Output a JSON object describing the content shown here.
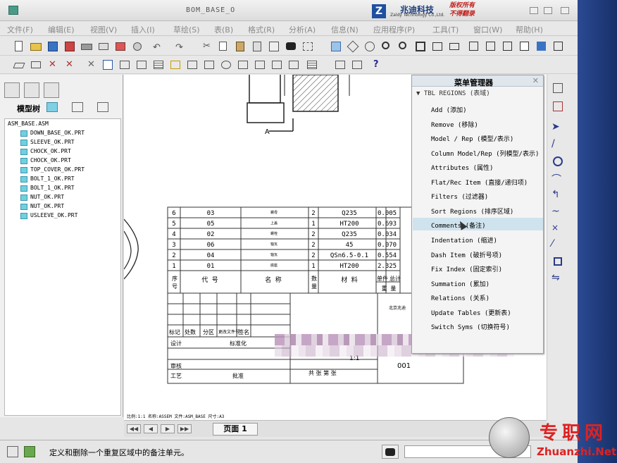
{
  "window": {
    "title": "BOM_BASE_O",
    "logo_text": "兆迪科技",
    "logo_en": "Zaldy Technology Co.,Ltd.",
    "rights_line1": "版权所有",
    "rights_line2": "不得翻录"
  },
  "menu": [
    "文件(F)",
    "编辑(E)",
    "视图(V)",
    "插入(I)",
    "草绘(S)",
    "表(B)",
    "格式(R)",
    "分析(A)",
    "信息(N)",
    "应用程序(P)",
    "工具(T)",
    "窗口(W)",
    "帮助(H)"
  ],
  "model_tree": {
    "label": "模型树",
    "root": "ASM_BASE.ASM",
    "items": [
      "DOWN_BASE_OK.PRT",
      "SLEEVE_OK.PRT",
      "CHOCK_OK.PRT",
      "CHOCK_OK.PRT",
      "TOP_COVER_OK.PRT",
      "BOLT_1_OK.PRT",
      "BOLT_1_OK.PRT",
      "NUT_OK.PRT",
      "NUT_OK.PRT",
      "USLEEVE_OK.PRT"
    ]
  },
  "drawing": {
    "view_label": "A",
    "bom_rows": [
      {
        "no": "6",
        "code": "03",
        "name": "螺母",
        "qty": "2",
        "mat": "Q235",
        "w": "0.005"
      },
      {
        "no": "5",
        "code": "05",
        "name": "上盖",
        "qty": "1",
        "mat": "HT200",
        "w": "0.693"
      },
      {
        "no": "4",
        "code": "02",
        "name": "螺栓",
        "qty": "2",
        "mat": "Q235",
        "w": "0.034"
      },
      {
        "no": "3",
        "code": "06",
        "name": "轴瓦",
        "qty": "2",
        "mat": "45",
        "w": "0.070"
      },
      {
        "no": "2",
        "code": "04",
        "name": "轴瓦",
        "qty": "2",
        "mat": "QSn6.5-0.1",
        "w": "0.554"
      },
      {
        "no": "1",
        "code": "01",
        "name": "底座",
        "qty": "1",
        "mat": "HT200",
        "w": "2.325"
      }
    ],
    "bom_header": {
      "no": "序号",
      "code": "代  号",
      "name": "名  称",
      "qty": "数量",
      "mat": "材  料",
      "single": "单件",
      "total": "总计",
      "weight": "重  量"
    },
    "title_block": {
      "c1": "标记",
      "c2": "处数",
      "c3": "分区",
      "c4": "更改文件号",
      "c5": "签名",
      "design": "设计",
      "std": "标准化",
      "review": "审核",
      "process": "工艺",
      "approve": "批准",
      "scale": "1:1",
      "sheet": "共 张 第 张",
      "code": "001",
      "company": "北京兆迪"
    },
    "footer_text": "比例:1:1    名称:ASSEM    文件:ASM_BASE    尺寸:A3"
  },
  "menu_manager": {
    "title": "菜单管理器",
    "section": "▼ TBL REGIONS (表域)",
    "items": [
      "Add (添加)",
      "Remove (移除)",
      "Model / Rep (模型/表示)",
      "Column Model/Rep (列模型/表示)",
      "Attributes (属性)",
      "Flat/Rec Item (直接/递归项)",
      "Filters (过滤器)",
      "Sort Regions (排序区域)",
      "Comments (备注)",
      "Indentation (缩进)",
      "Dash Item (破折号项)",
      "Fix Index (固定索引)",
      "Summation (累加)",
      "Relations (关系)",
      "Update Tables (更新表)",
      "Switch Syms (切换符号)"
    ],
    "selected_index": 8
  },
  "pagenav": {
    "page_label": "页面 1"
  },
  "status": {
    "message": "定义和删除一个重复区域中的备注单元。"
  },
  "watermark": {
    "cn": "专职网",
    "en": "Zhuanzhi.Net"
  }
}
